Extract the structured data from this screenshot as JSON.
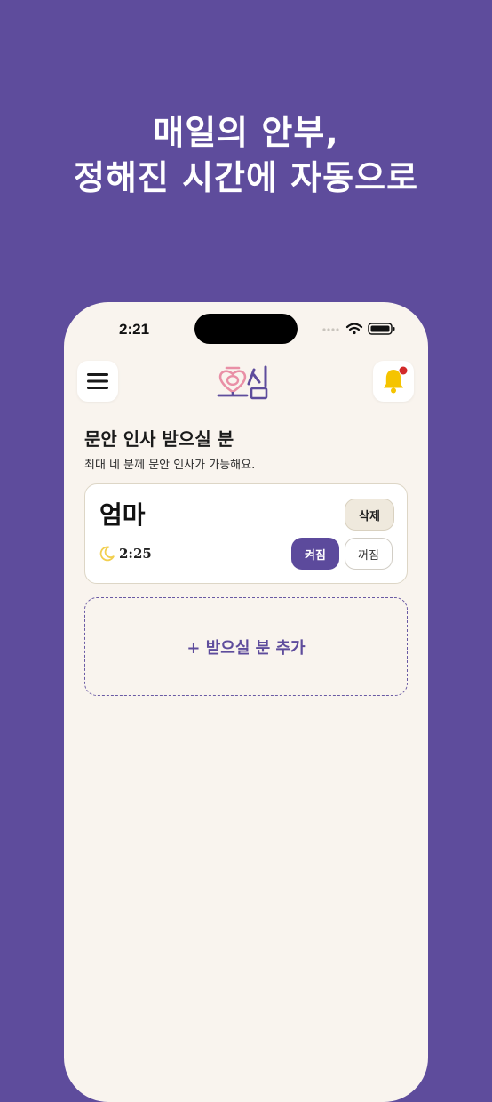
{
  "promo": {
    "line1": "매일의 안부,",
    "line2": "정해진 시간에 자동으로"
  },
  "status_bar": {
    "time": "2:21"
  },
  "header": {
    "menu_icon": "hamburger-menu-icon",
    "logo_text": "효심",
    "bell_icon": "bell-icon",
    "has_notification": true
  },
  "section": {
    "title": "문안 인사 받으실 분",
    "subtitle": "최대 네 분께 문안 인사가 가능해요."
  },
  "recipients": [
    {
      "name": "엄마",
      "time": "2:25",
      "time_icon": "moon-icon",
      "delete_label": "삭제",
      "on_label": "켜짐",
      "off_label": "꺼짐",
      "enabled": true
    }
  ],
  "add_recipient_label": "+ 받으실 분 추가",
  "colors": {
    "brand_purple": "#5e4c9c",
    "card_bg": "#ffffff",
    "screen_bg": "#f9f4ee",
    "bell_yellow": "#f5c400",
    "notification_dot": "#d22a2a",
    "logo_pink": "#e98fa6"
  }
}
